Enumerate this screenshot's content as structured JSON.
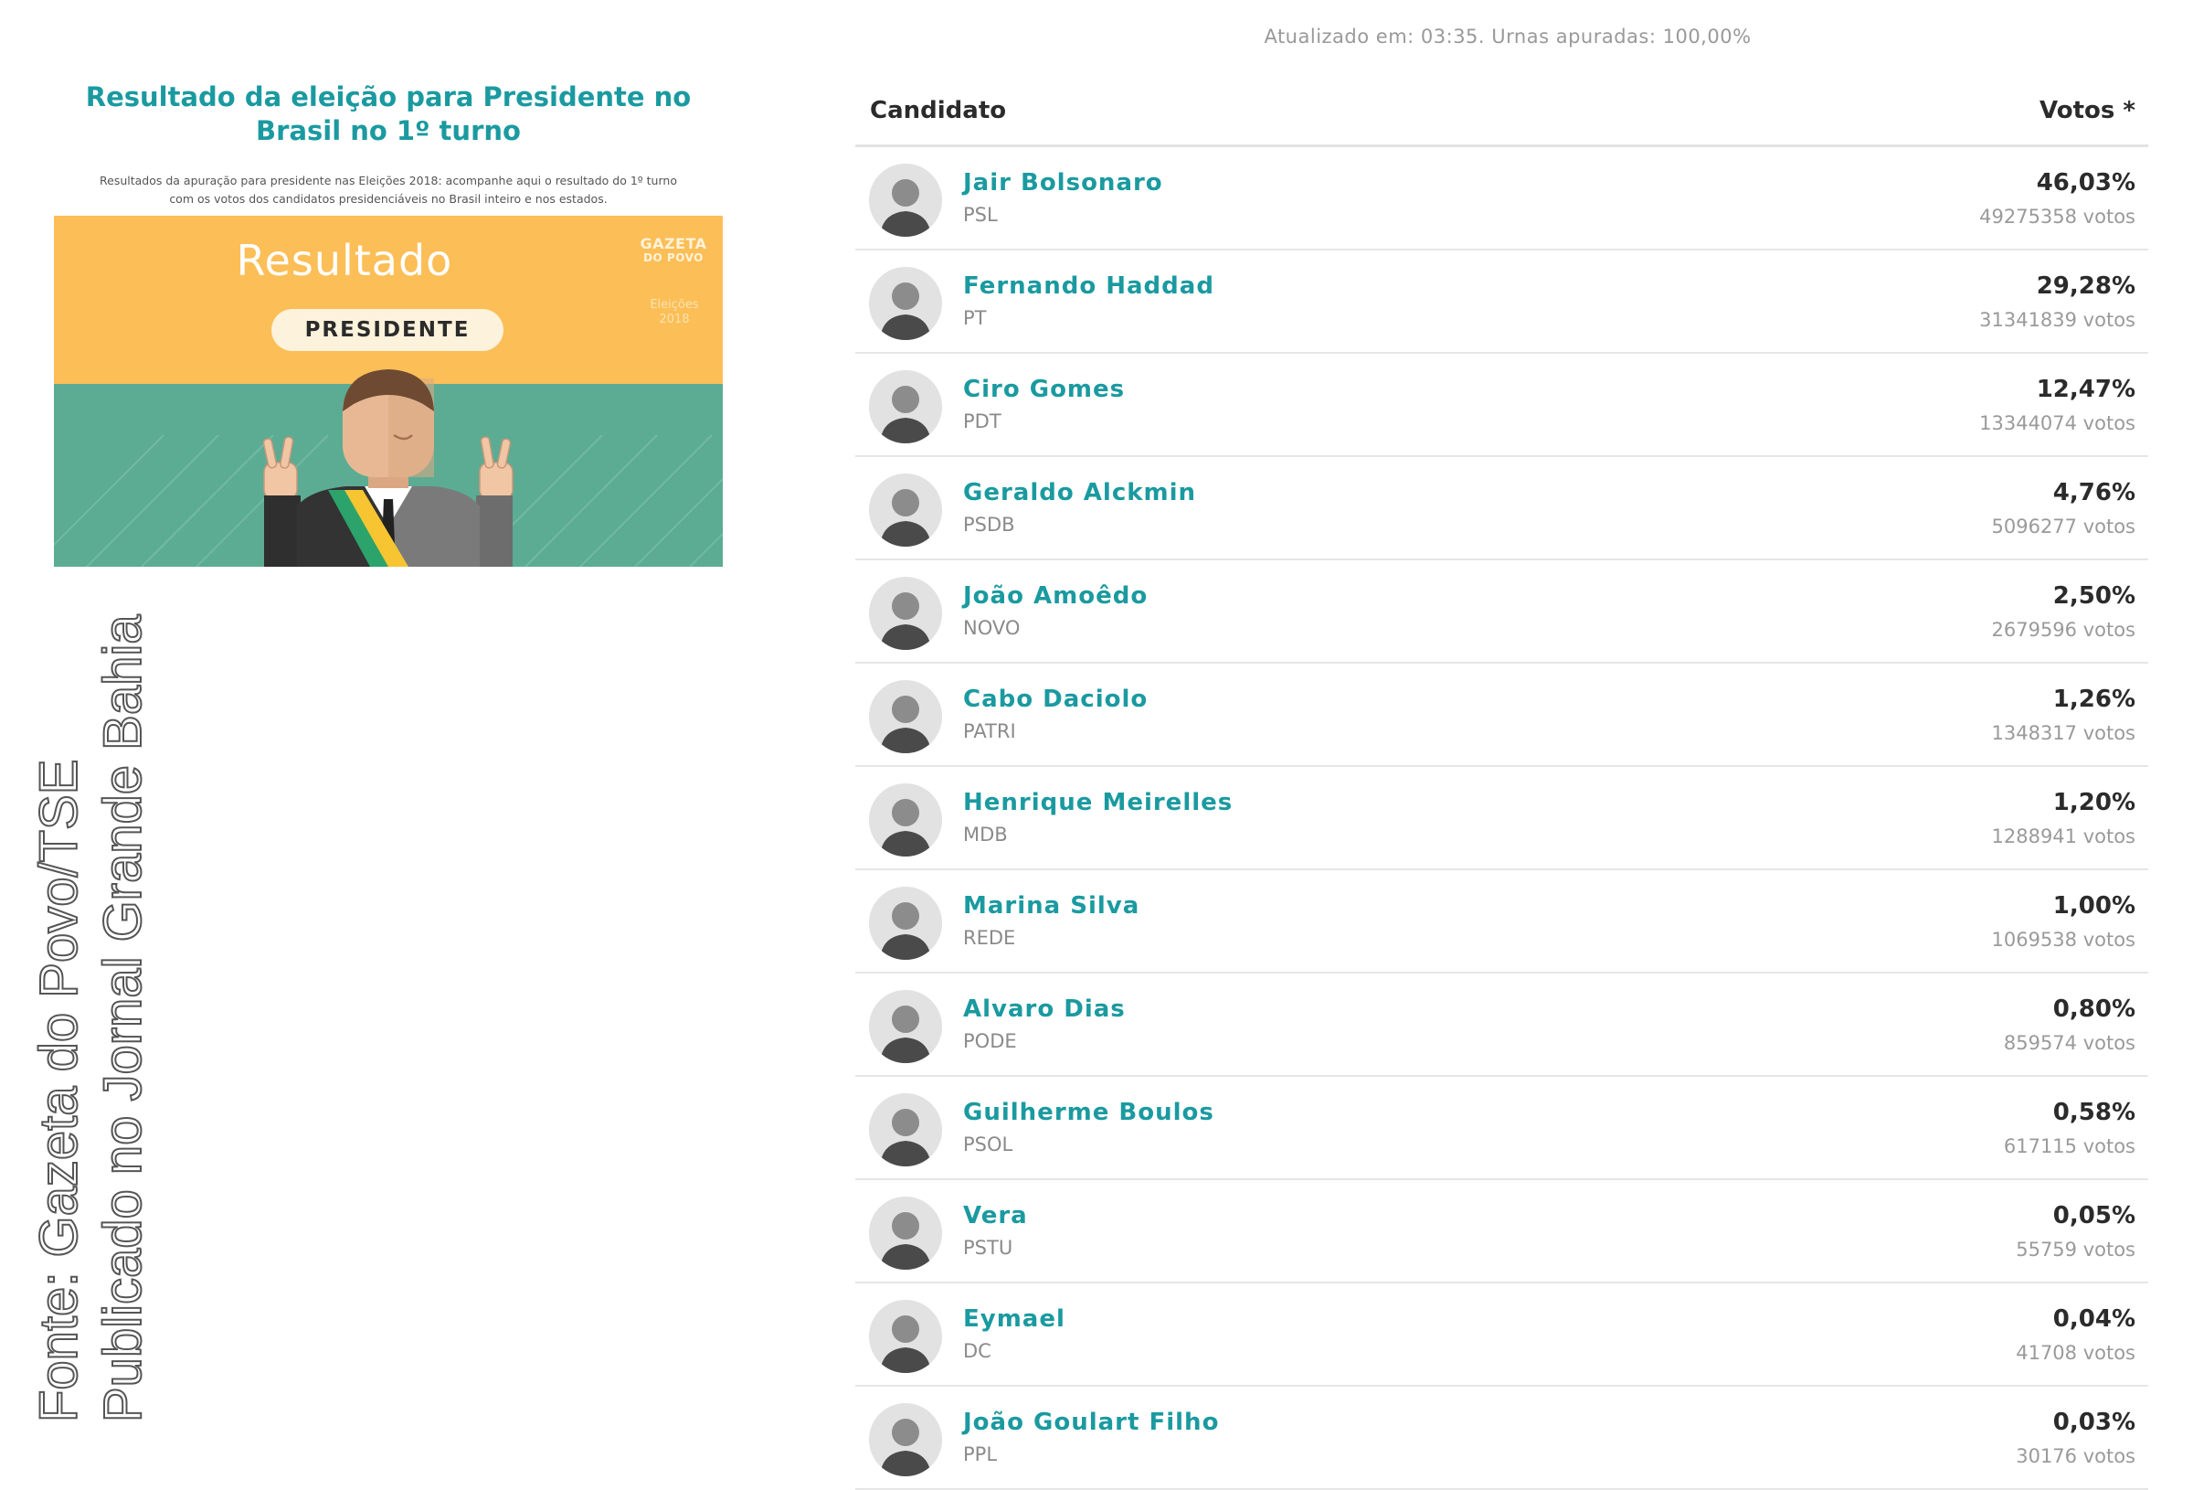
{
  "header": {
    "updated_text": "Atualizado em: 03:35. Urnas apuradas: 100,00%"
  },
  "article": {
    "title": "Resultado da eleição para Presidente no Brasil no 1º turno",
    "description": "Resultados da apuração para presidente nas Eleições 2018: acompanhe aqui o resultado do 1º turno com os votos dos candidatos presidenciáveis no Brasil inteiro e nos estados.",
    "banner": {
      "heading": "Resultado",
      "pill_label": "PRESIDENTE",
      "logo_line1": "GAZETA",
      "logo_line2": "DO POVO",
      "sub_line1": "Eleições",
      "sub_line2": "2018",
      "colors": {
        "top": "#fcbe57",
        "bottom": "#5bac93"
      }
    }
  },
  "credit": {
    "line1": "Fonte: Gazeta do Povo/TSE",
    "line2": "Publicado no Jornal Grande Bahia"
  },
  "results": {
    "col_candidate": "Candidato",
    "col_votes": "Votos *",
    "accent_color": "#1a9aa0",
    "candidates": [
      {
        "name": "Jair Bolsonaro",
        "party": "PSL",
        "percent": "46,03%",
        "votes": "49275358 votos"
      },
      {
        "name": "Fernando Haddad",
        "party": "PT",
        "percent": "29,28%",
        "votes": "31341839 votos"
      },
      {
        "name": "Ciro Gomes",
        "party": "PDT",
        "percent": "12,47%",
        "votes": "13344074 votos"
      },
      {
        "name": "Geraldo Alckmin",
        "party": "PSDB",
        "percent": "4,76%",
        "votes": "5096277 votos"
      },
      {
        "name": "João Amoêdo",
        "party": "NOVO",
        "percent": "2,50%",
        "votes": "2679596 votos"
      },
      {
        "name": "Cabo Daciolo",
        "party": "PATRI",
        "percent": "1,26%",
        "votes": "1348317 votos"
      },
      {
        "name": "Henrique Meirelles",
        "party": "MDB",
        "percent": "1,20%",
        "votes": "1288941 votos"
      },
      {
        "name": "Marina Silva",
        "party": "REDE",
        "percent": "1,00%",
        "votes": "1069538 votos"
      },
      {
        "name": "Alvaro Dias",
        "party": "PODE",
        "percent": "0,80%",
        "votes": "859574 votos"
      },
      {
        "name": "Guilherme Boulos",
        "party": "PSOL",
        "percent": "0,58%",
        "votes": "617115 votos"
      },
      {
        "name": "Vera",
        "party": "PSTU",
        "percent": "0,05%",
        "votes": "55759 votos"
      },
      {
        "name": "Eymael",
        "party": "DC",
        "percent": "0,04%",
        "votes": "41708 votos"
      },
      {
        "name": "João Goulart Filho",
        "party": "PPL",
        "percent": "0,03%",
        "votes": "30176 votos"
      }
    ]
  }
}
